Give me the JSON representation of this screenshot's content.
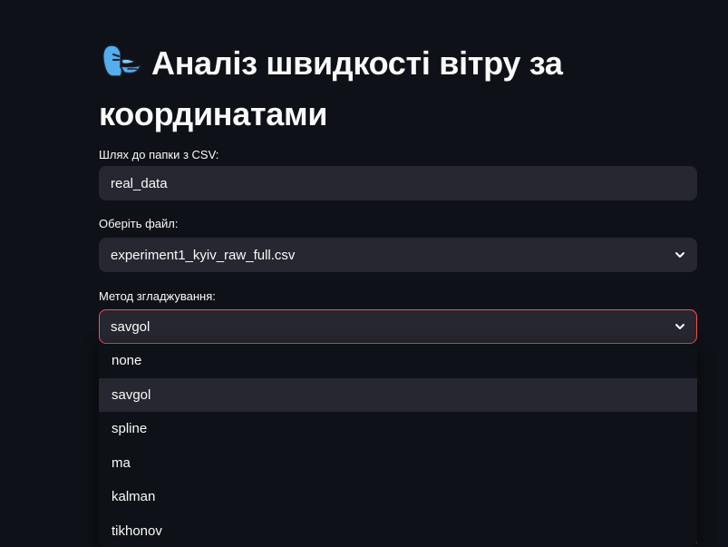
{
  "header": {
    "icon": "wind-face-icon",
    "title": "Аналіз швидкості вітру за координатами"
  },
  "folder_field": {
    "label": "Шлях до папки з CSV:",
    "value": "real_data"
  },
  "file_select": {
    "label": "Оберіть файл:",
    "selected": "experiment1_kyiv_raw_full.csv"
  },
  "method_select": {
    "label": "Метод згладжування:",
    "selected": "savgol",
    "options": [
      "none",
      "savgol",
      "spline",
      "ma",
      "kalman",
      "tikhonov"
    ]
  },
  "colors": {
    "background": "#0e1117",
    "input_bg": "#262730",
    "focus_border": "#ff4b4b",
    "icon_blue": "#55acee"
  }
}
